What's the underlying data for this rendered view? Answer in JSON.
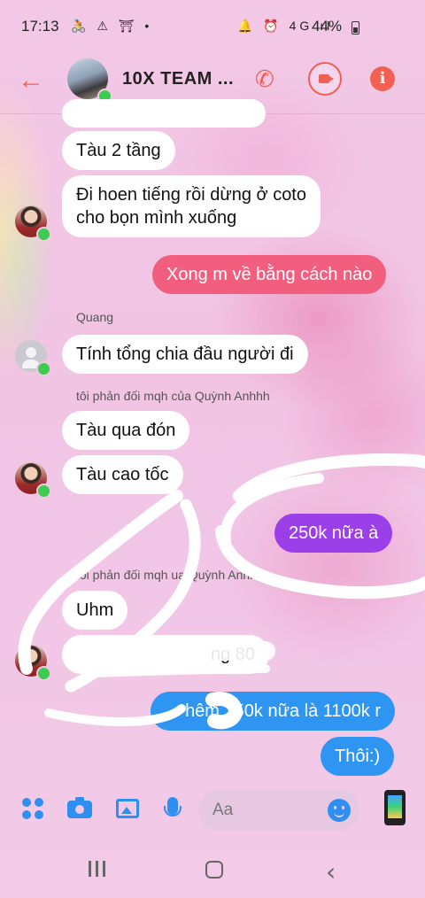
{
  "status_bar": {
    "time": "17:13",
    "left_icons": "🚴 ⚠ ⛩ •",
    "right_icons": "🔔 ⏰ 4G ıl",
    "battery": "44%"
  },
  "header": {
    "title": "10X TEAM ...",
    "back_icon": "arrow-left-icon",
    "call_icon": "phone-icon",
    "video_icon": "video-camera-icon",
    "info_icon": "info-icon",
    "info_glyph": "i"
  },
  "messages": [
    {
      "id": "m1",
      "side": "left",
      "text": "Tàu 2 tầng"
    },
    {
      "id": "m2",
      "side": "left",
      "lines": [
        "Đi hoen tiếng rồi dừng ở coto",
        "cho bọn mình xuống"
      ]
    },
    {
      "id": "m3",
      "side": "right",
      "color": "#f25e7d",
      "text": "Xong m về bằng cách nào"
    },
    {
      "id": "m4",
      "side": "left",
      "sender": "Quang",
      "text": "Tính tổng chia đầu người đi"
    },
    {
      "id": "m5",
      "side": "left",
      "reply_note": "tôi phản đối mqh của Quỳnh Anhhh",
      "text": "Tàu qua đón"
    },
    {
      "id": "m6",
      "side": "left",
      "text": "Tàu cao tốc"
    },
    {
      "id": "m7",
      "side": "right",
      "color": "#9b3fe8",
      "text": "250k nữa à"
    },
    {
      "id": "m8",
      "side": "left",
      "reply_note": "tôi phản đối mqh   ua Quỳnh Anhhh",
      "text": "Uhm"
    },
    {
      "id": "m9",
      "side": "left",
      "text": "ng 80"
    },
    {
      "id": "m10",
      "side": "right",
      "color": "#2e95f3",
      "text": "hêm 250k nữa là 1100k r"
    },
    {
      "id": "m11",
      "side": "right",
      "color": "#2e95f3",
      "text": "Thôi:)"
    }
  ],
  "composer": {
    "placeholder": "Aa",
    "icons": [
      "apps-icon",
      "camera-icon",
      "gallery-icon",
      "microphone-icon",
      "emoji-icon",
      "phone-app-icon"
    ]
  },
  "nav_bar": {
    "icons": [
      "recent-apps-icon",
      "home-icon",
      "back-icon"
    ],
    "back_glyph": "‹"
  },
  "colors": {
    "accent": "#f05e52",
    "outgoing_pink": "#f25e7d",
    "outgoing_purple": "#9b3fe8",
    "outgoing_blue": "#2e95f3",
    "incoming": "#ffffff"
  }
}
